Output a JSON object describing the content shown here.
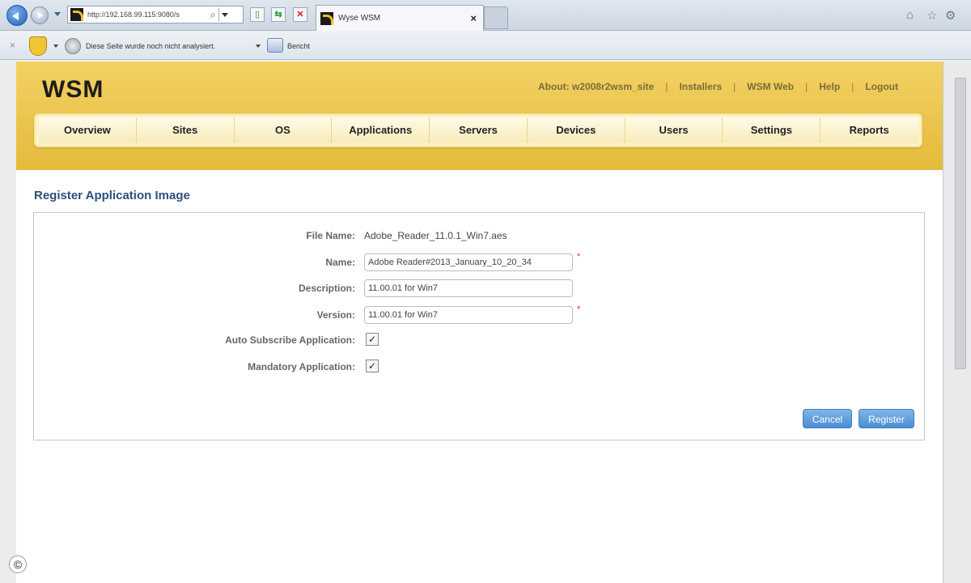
{
  "browser": {
    "url": "http://192.168.99.115:9080/s",
    "tab_title": "Wyse WSM",
    "tab_close": "×",
    "analysis_text": "Diese Seite wurde noch nicht analysiert.",
    "report_label": "Bericht",
    "bar_close": "×"
  },
  "header": {
    "logo": "WSM",
    "links": {
      "about": "About: w2008r2wsm_site",
      "installers": "Installers",
      "wsm_web": "WSM Web",
      "help": "Help",
      "logout": "Logout"
    },
    "separator": "|"
  },
  "menu": {
    "overview": "Overview",
    "sites": "Sites",
    "os": "OS",
    "applications": "Applications",
    "servers": "Servers",
    "devices": "Devices",
    "users": "Users",
    "settings": "Settings",
    "reports": "Reports"
  },
  "page": {
    "title": "Register Application Image"
  },
  "form": {
    "file_name_label": "File Name:",
    "file_name_value": "Adobe_Reader_11.0.1_Win7.aes",
    "name_label": "Name:",
    "name_value": "Adobe Reader#2013_January_10_20_34",
    "description_label": "Description:",
    "description_value": "11.00.01 for Win7",
    "version_label": "Version:",
    "version_value": "11.00.01 for Win7",
    "auto_subscribe_label": "Auto Subscribe Application:",
    "mandatory_label": "Mandatory Application:",
    "required_marker": "*",
    "check_mark": "✓",
    "cancel_label": "Cancel",
    "register_label": "Register"
  },
  "copyright_symbol": "©"
}
